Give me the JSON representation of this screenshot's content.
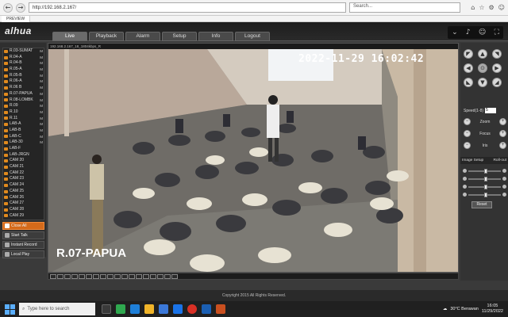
{
  "browser": {
    "url": "http://192.168.2.167/",
    "search_placeholder": "Search...",
    "tab_title": "PREVIEW"
  },
  "app": {
    "logo": "alhua",
    "tabs": [
      {
        "label": "Live",
        "active": true
      },
      {
        "label": "Playback",
        "active": false
      },
      {
        "label": "Alarm",
        "active": false
      },
      {
        "label": "Setup",
        "active": false
      },
      {
        "label": "Info",
        "active": false
      },
      {
        "label": "Logout",
        "active": false
      }
    ],
    "footer": "Copyright 2015 All Rights Reserved."
  },
  "cameras": [
    {
      "name": "R.03-SUMAT",
      "flag": "M"
    },
    {
      "name": "R.04-A",
      "flag": "M"
    },
    {
      "name": "R.04-B",
      "flag": "M"
    },
    {
      "name": "R.05-A",
      "flag": "M"
    },
    {
      "name": "R.05-B",
      "flag": "M"
    },
    {
      "name": "R.06-A",
      "flag": "M"
    },
    {
      "name": "R.06 B",
      "flag": "M"
    },
    {
      "name": "R.07-PAPUA",
      "flag": "M"
    },
    {
      "name": "R.08-LOMBK",
      "flag": "M"
    },
    {
      "name": "R.09",
      "flag": "M"
    },
    {
      "name": "R.10",
      "flag": "M"
    },
    {
      "name": "R.11",
      "flag": "M"
    },
    {
      "name": "LAB-A",
      "flag": "M"
    },
    {
      "name": "LAB-B",
      "flag": "M"
    },
    {
      "name": "LAB-C",
      "flag": "M"
    },
    {
      "name": "LAB-30",
      "flag": "M"
    },
    {
      "name": "LAB-F",
      "flag": ""
    },
    {
      "name": "LAB-JRGN",
      "flag": ""
    },
    {
      "name": "CAM 20",
      "flag": ""
    },
    {
      "name": "CAM 21",
      "flag": ""
    },
    {
      "name": "CAM 22",
      "flag": ""
    },
    {
      "name": "CAM 23",
      "flag": ""
    },
    {
      "name": "CAM 24",
      "flag": ""
    },
    {
      "name": "CAM 25",
      "flag": ""
    },
    {
      "name": "CAM 26",
      "flag": ""
    },
    {
      "name": "CAM 27",
      "flag": ""
    },
    {
      "name": "CAM 28",
      "flag": ""
    },
    {
      "name": "CAM 29",
      "flag": ""
    }
  ],
  "left_buttons": {
    "close_all": "Close All",
    "start_talk": "Start Talk",
    "instant_record": "Instant Record",
    "local_play": "Local Play"
  },
  "video": {
    "stream_info": "192.168.2.167_18_1804kbps_R",
    "timestamp": "2022-11-29 16:02:42",
    "camera_label": "R.07-PAPUA"
  },
  "ptz": {
    "speed_label": "Speed(1-8)",
    "speed_value": "5",
    "zoom": "Zoom",
    "focus": "Focus",
    "iris": "Iris"
  },
  "image_setup": {
    "title": "Image Setup",
    "roll_out": "Roll-out",
    "reset": "Reset",
    "levels": [
      0.5,
      0.5,
      0.5,
      0.5
    ]
  },
  "taskbar": {
    "search_placeholder": "Type here to search",
    "weather": "30°C  Berawan",
    "time": "16:05",
    "date": "11/29/2022"
  }
}
